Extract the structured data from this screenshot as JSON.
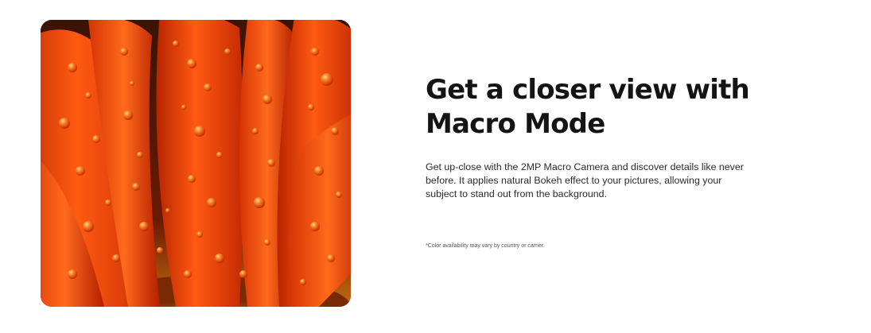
{
  "feature": {
    "headline": "Get a closer view with Macro Mode",
    "description": "Get up-close with the 2MP Macro Camera and discover details like never before. It applies natural Bokeh effect to your pictures, allowing your subject to stand out from the background.",
    "disclaimer": "*Color availability may vary by country or carrier."
  },
  "image": {
    "subject": "macro-photo-orange-petals-with-water-droplets"
  },
  "colors": {
    "petal": "#ff4a0a",
    "petal_dark": "#8a1a00",
    "headline": "#141414",
    "body": "#2b2b2b"
  }
}
